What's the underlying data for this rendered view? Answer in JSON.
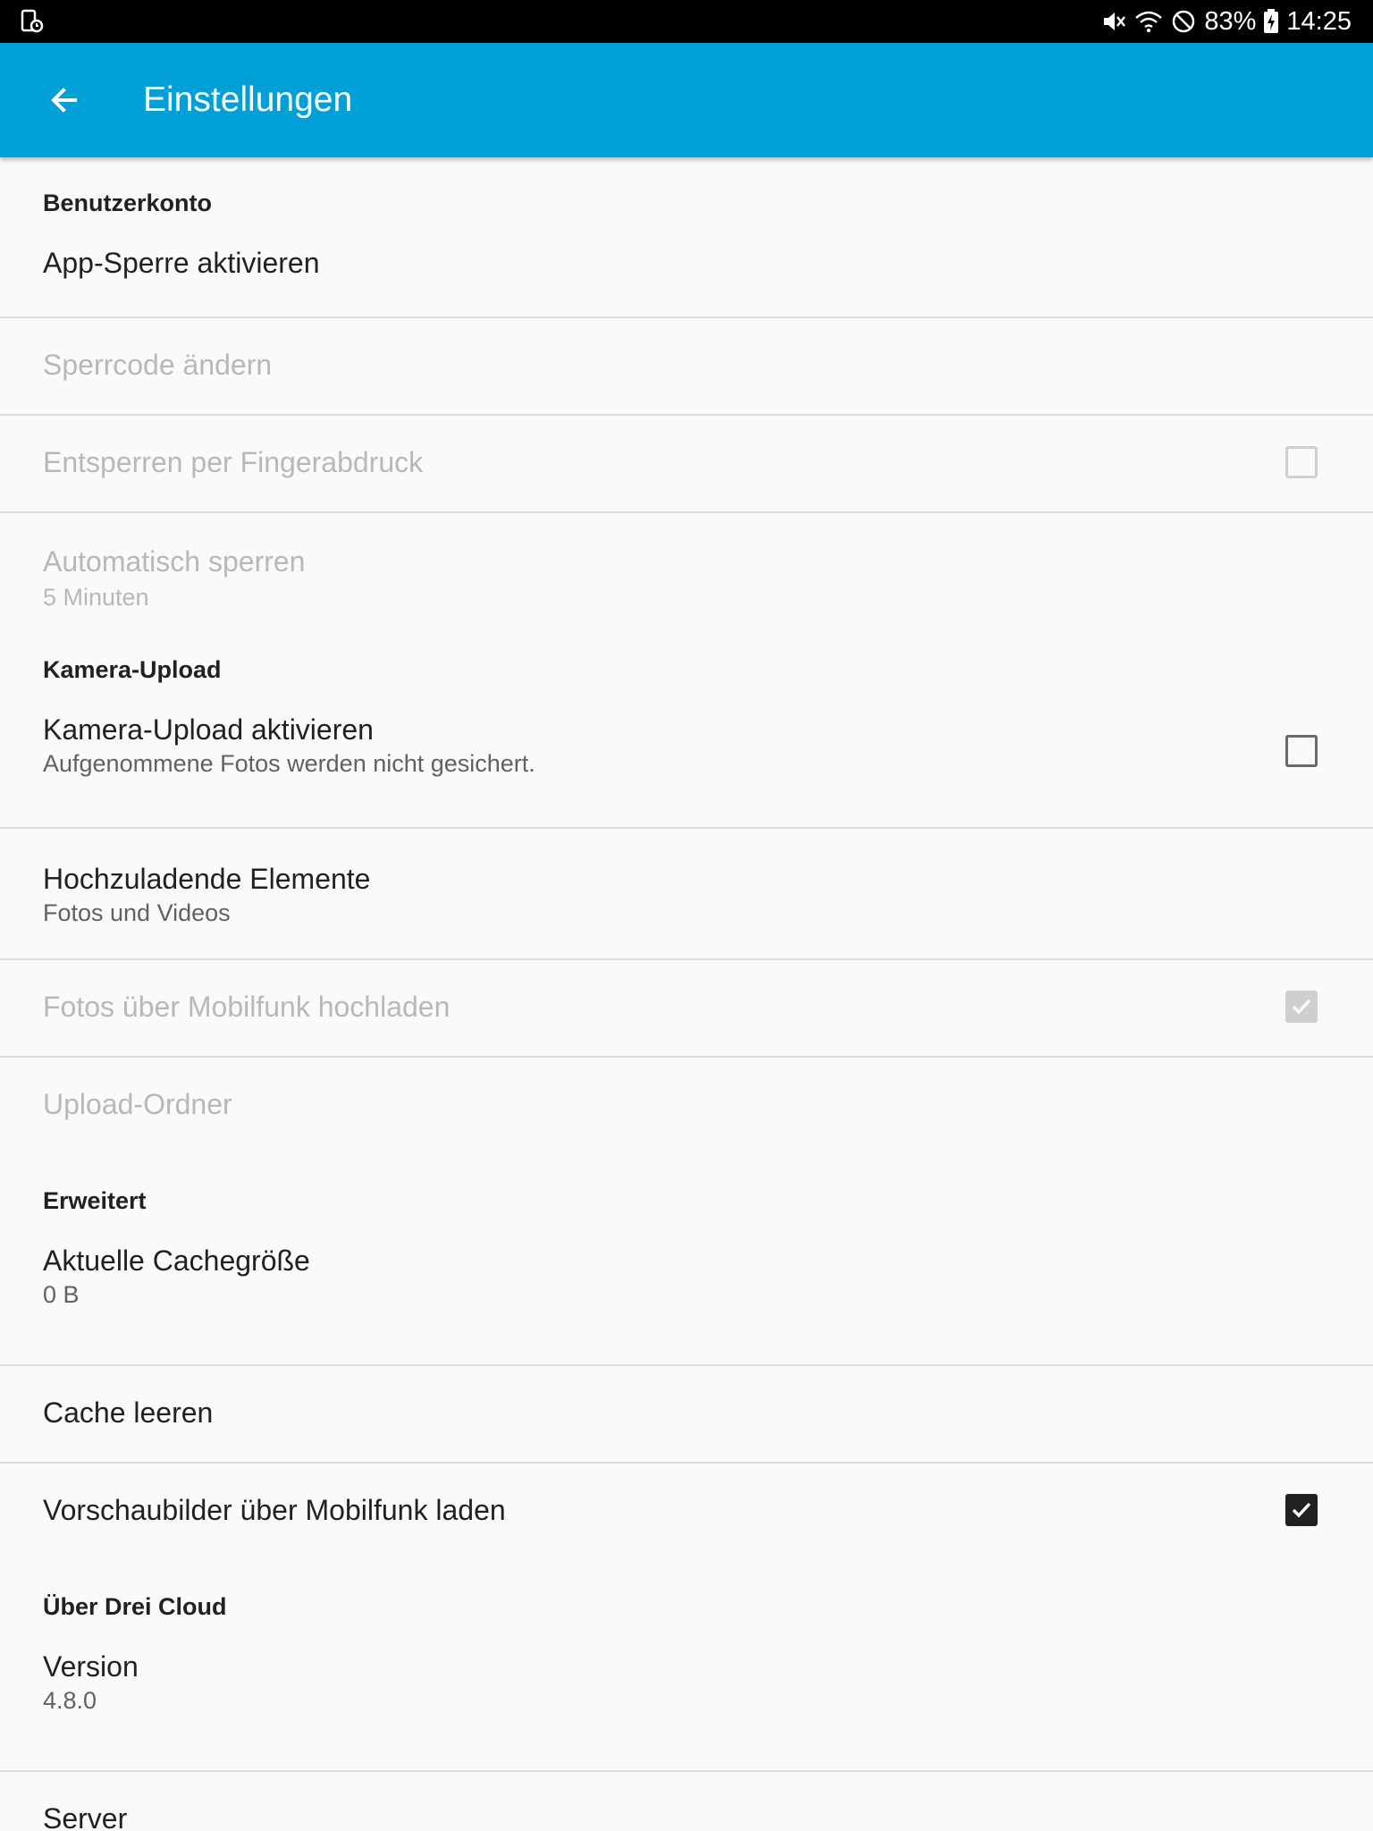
{
  "statusbar": {
    "left_icon": "screen-rotate-icon",
    "mute_icon": "mute-icon",
    "wifi_icon": "wifi-icon",
    "dnd_icon": "do-not-disturb-icon",
    "battery_percent": "83%",
    "battery_icon": "battery-charging-icon",
    "time": "14:25"
  },
  "appbar": {
    "back_icon": "arrow-back-icon",
    "title": "Einstellungen",
    "color": "#00a0d6"
  },
  "sections": {
    "account": {
      "header": "Benutzerkonto",
      "app_lock": {
        "title": "App-Sperre aktivieren"
      },
      "change_code": {
        "title": "Sperrcode ändern"
      },
      "fingerprint": {
        "title": "Entsperren per Fingerabdruck",
        "checked": false,
        "enabled": false
      },
      "auto_lock": {
        "title": "Automatisch sperren",
        "summary": "5 Minuten"
      }
    },
    "camera": {
      "header": "Kamera-Upload",
      "enable": {
        "title": "Kamera-Upload aktivieren",
        "summary": "Aufgenommene Fotos werden nicht gesichert.",
        "checked": false
      },
      "elements": {
        "title": "Hochzuladende Elemente",
        "summary": "Fotos und Videos"
      },
      "mobile": {
        "title": "Fotos über Mobilfunk hochladen",
        "checked": true,
        "enabled": false
      },
      "folder": {
        "title": "Upload-Ordner"
      }
    },
    "advanced": {
      "header": "Erweitert",
      "cache_size": {
        "title": "Aktuelle Cachegröße",
        "summary": "0 B"
      },
      "clear_cache": {
        "title": "Cache leeren"
      },
      "thumbnails": {
        "title": "Vorschaubilder über Mobilfunk laden",
        "checked": true
      }
    },
    "about": {
      "header": "Über Drei Cloud",
      "version": {
        "title": "Version",
        "summary": "4.8.0"
      },
      "server": {
        "title": "Server"
      }
    }
  }
}
